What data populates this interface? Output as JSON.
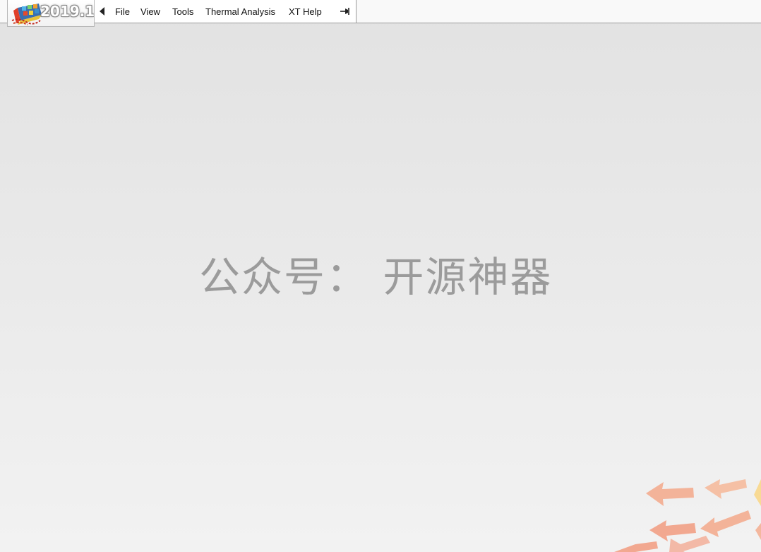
{
  "app": {
    "version_badge": "2019.1"
  },
  "menubar": {
    "items": [
      {
        "label": "File"
      },
      {
        "label": "View"
      },
      {
        "label": "Tools"
      },
      {
        "label": "Thermal Analysis"
      },
      {
        "label": "XT Help"
      }
    ]
  },
  "watermark": {
    "text": "公众号： 开源神器"
  },
  "colors": {
    "background_top": "#e2e2e2",
    "background_bottom": "#f2f2f2",
    "watermark": "#9b9b9b",
    "arrow_decor": "#f4a98a"
  }
}
